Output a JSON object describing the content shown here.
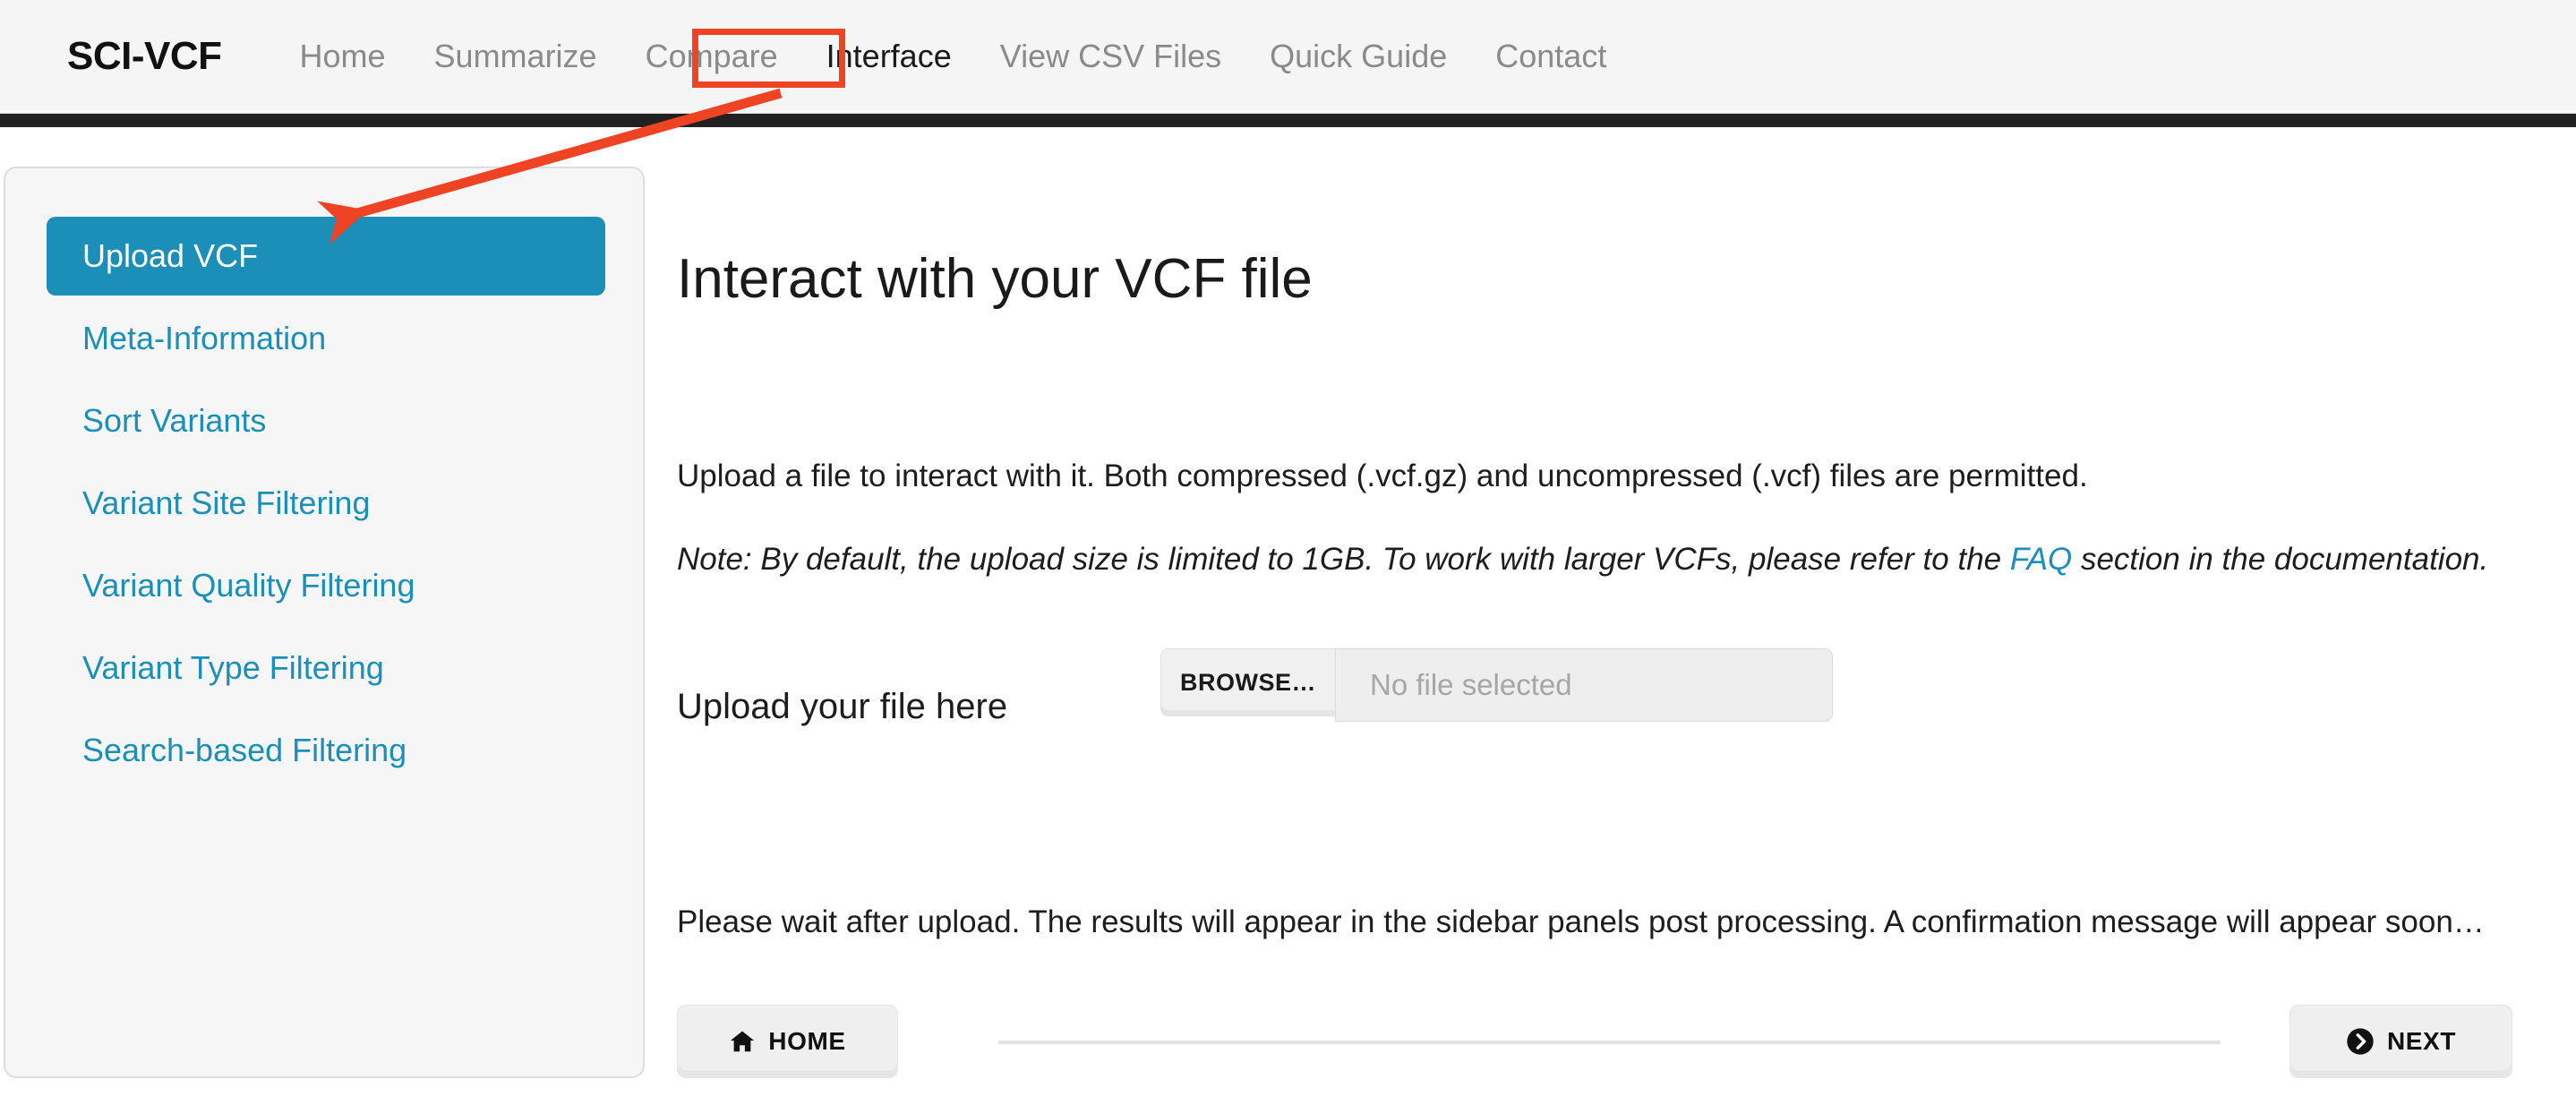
{
  "navbar": {
    "brand": "SCI-VCF",
    "links": [
      {
        "label": "Home",
        "active": false
      },
      {
        "label": "Summarize",
        "active": false
      },
      {
        "label": "Compare",
        "active": false
      },
      {
        "label": "Interface",
        "active": true
      },
      {
        "label": "View CSV Files",
        "active": false
      },
      {
        "label": "Quick Guide",
        "active": false
      },
      {
        "label": "Contact",
        "active": false
      }
    ],
    "highlight_color": "#ef4423",
    "underbar_color": "#212121"
  },
  "annotation": {
    "type": "arrow",
    "color": "#ef4423",
    "points_from": "Interface",
    "points_to": "Upload VCF"
  },
  "sidebar": {
    "accent_color": "#1b8fb8",
    "items": [
      {
        "label": "Upload VCF",
        "active": true
      },
      {
        "label": "Meta-Information",
        "active": false
      },
      {
        "label": "Sort Variants",
        "active": false
      },
      {
        "label": "Variant Site Filtering",
        "active": false
      },
      {
        "label": "Variant Quality Filtering",
        "active": false
      },
      {
        "label": "Variant Type Filtering",
        "active": false
      },
      {
        "label": "Search-based Filtering",
        "active": false
      }
    ]
  },
  "main": {
    "title": "Interact with your VCF file",
    "intro": "Upload a file to interact with it. Both compressed (.vcf.gz) and uncompressed (.vcf) files are permitted.",
    "note_prefix": "Note: By default, the upload size is limited to 1GB. To work with larger VCFs, please refer to the ",
    "note_link": "FAQ",
    "note_suffix": " section in the documentation.",
    "upload_label": "Upload your file here",
    "browse_button": "BROWSE…",
    "file_placeholder": "No file selected",
    "wait_message": "Please wait after upload. The results will appear in the sidebar panels post processing. A confirmation message will appear soon…"
  },
  "footer": {
    "home_button": "HOME",
    "next_button": "NEXT"
  }
}
